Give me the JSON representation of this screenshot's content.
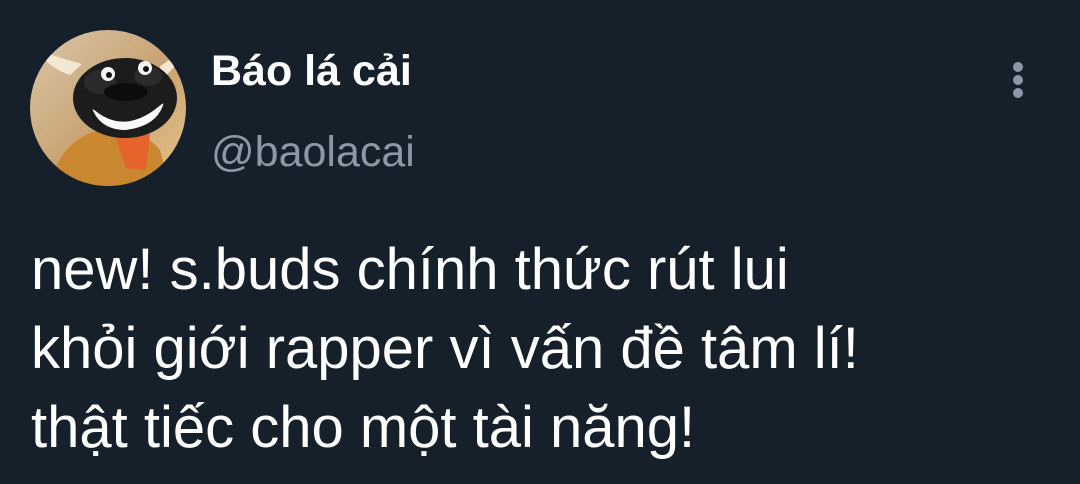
{
  "author": {
    "display_name": "Báo lá cải",
    "handle": "@baolacai",
    "avatar_icon": "cartoon-buffalo-avatar"
  },
  "menu": {
    "icon": "more-vertical-icon"
  },
  "tweet": {
    "lines": [
      "new! s.buds chính thức rút lui",
      "khỏi giới rapper vì vấn đề tâm lí!",
      "thật tiếc cho một tài năng!"
    ]
  },
  "colors": {
    "background": "#15202b",
    "primary_text": "#ffffff",
    "secondary_text": "#8b98a5"
  }
}
